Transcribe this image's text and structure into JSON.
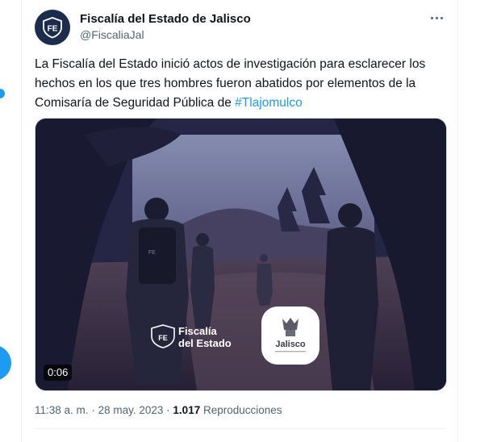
{
  "tweet": {
    "display_name": "Fiscalía del Estado de Jalisco",
    "handle": "@FiscaliaJal",
    "avatar_initials": "FE",
    "text_main": "La Fiscalía del Estado inició actos de investigación para esclarecer los hechos en los que tres hombres fueron abatidos por elementos de la Comisaría de Seguridad Pública de ",
    "hashtag": "#Tlajomulco",
    "media": {
      "type": "video",
      "duration": "0:06",
      "watermark_fiscalia_line1": "Fiscalía",
      "watermark_fiscalia_line2": "del Estado",
      "watermark_jalisco": "Jalisco",
      "vest_text": "FE"
    },
    "time": "11:38 a. m.",
    "separator": "·",
    "date": "28 may. 2023",
    "views_count": "1.017",
    "views_label": "Reproducciones"
  },
  "colors": {
    "accent": "#1d9bf0",
    "text_primary": "#0f1419",
    "text_secondary": "#536471",
    "avatar_bg": "#1c2c4c"
  },
  "icons": {
    "more": "more-icon",
    "avatar": "fe-shield-logo"
  }
}
